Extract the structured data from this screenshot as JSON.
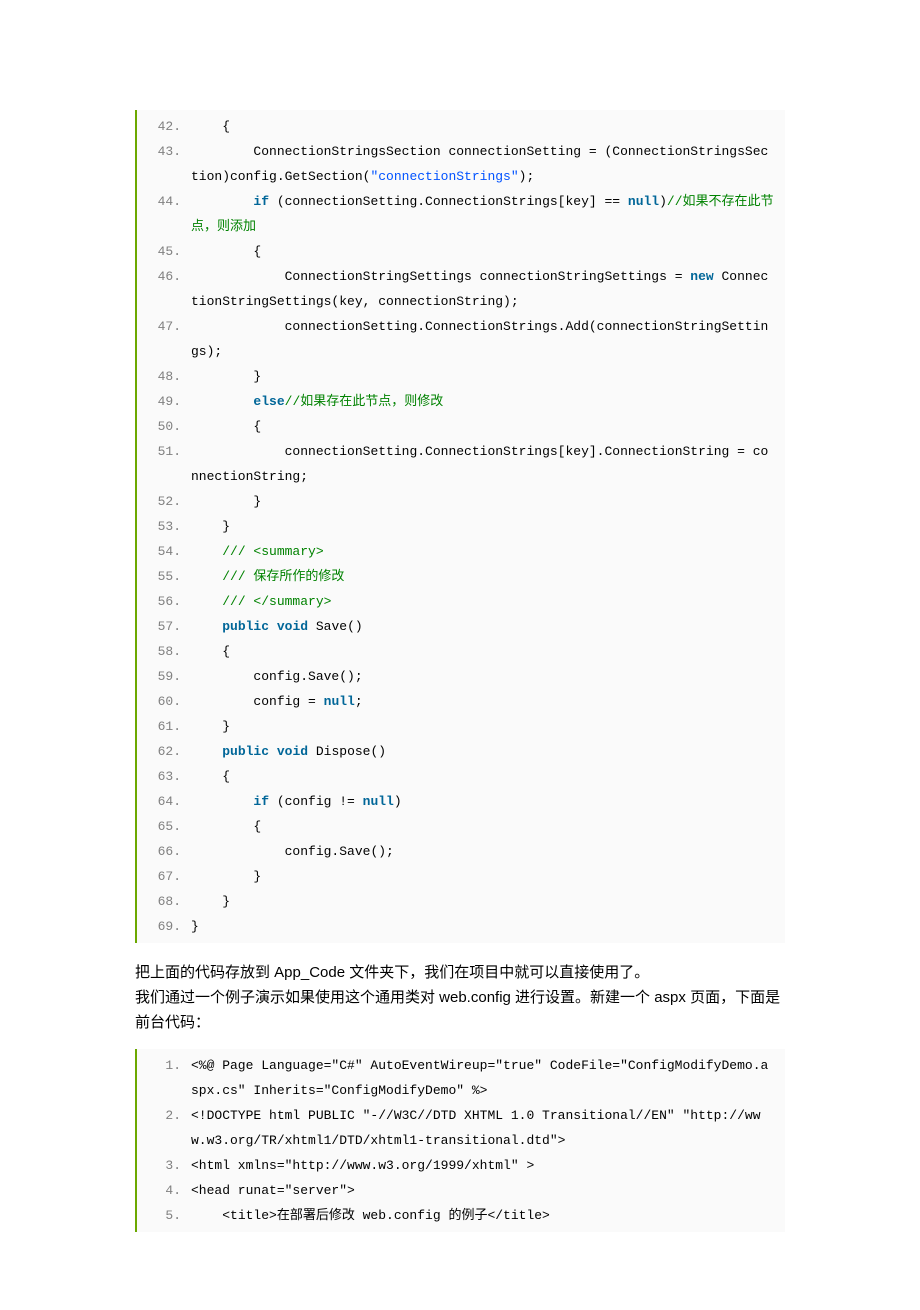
{
  "code1": {
    "start": 42,
    "lines": [
      [
        {
          "t": "    {",
          "c": ""
        }
      ],
      [
        {
          "t": "        ConnectionStringsSection connectionSetting = (ConnectionStringsSection)config.GetSection(",
          "c": ""
        },
        {
          "t": "\"connectionStrings\"",
          "c": "str"
        },
        {
          "t": ");",
          "c": ""
        }
      ],
      [
        {
          "t": "        ",
          "c": ""
        },
        {
          "t": "if",
          "c": "kw"
        },
        {
          "t": " (connectionSetting.ConnectionStrings[key] == ",
          "c": ""
        },
        {
          "t": "null",
          "c": "kw"
        },
        {
          "t": ")",
          "c": ""
        },
        {
          "t": "//如果不存在此节点，则添加",
          "c": "cmt"
        }
      ],
      [
        {
          "t": "        {",
          "c": ""
        }
      ],
      [
        {
          "t": "            ConnectionStringSettings connectionStringSettings = ",
          "c": ""
        },
        {
          "t": "new",
          "c": "kw"
        },
        {
          "t": " ConnectionStringSettings(key, connectionString);",
          "c": ""
        }
      ],
      [
        {
          "t": "            connectionSetting.ConnectionStrings.Add(connectionStringSettings);",
          "c": ""
        }
      ],
      [
        {
          "t": "        }",
          "c": ""
        }
      ],
      [
        {
          "t": "        ",
          "c": ""
        },
        {
          "t": "else",
          "c": "kw"
        },
        {
          "t": "//如果存在此节点，则修改",
          "c": "cmt"
        }
      ],
      [
        {
          "t": "        {",
          "c": ""
        }
      ],
      [
        {
          "t": "            connectionSetting.ConnectionStrings[key].ConnectionString = connectionString;",
          "c": ""
        }
      ],
      [
        {
          "t": "        }",
          "c": ""
        }
      ],
      [
        {
          "t": "    }",
          "c": ""
        }
      ],
      [
        {
          "t": "    ",
          "c": ""
        },
        {
          "t": "/// <summary>",
          "c": "cmt"
        }
      ],
      [
        {
          "t": "    ",
          "c": ""
        },
        {
          "t": "/// 保存所作的修改",
          "c": "cmt"
        }
      ],
      [
        {
          "t": "    ",
          "c": ""
        },
        {
          "t": "/// </summary>",
          "c": "cmt"
        }
      ],
      [
        {
          "t": "    ",
          "c": ""
        },
        {
          "t": "public",
          "c": "kw"
        },
        {
          "t": " ",
          "c": ""
        },
        {
          "t": "void",
          "c": "kw"
        },
        {
          "t": " Save()",
          "c": ""
        }
      ],
      [
        {
          "t": "    {",
          "c": ""
        }
      ],
      [
        {
          "t": "        config.Save();",
          "c": ""
        }
      ],
      [
        {
          "t": "        config = ",
          "c": ""
        },
        {
          "t": "null",
          "c": "kw"
        },
        {
          "t": ";",
          "c": ""
        }
      ],
      [
        {
          "t": "    }",
          "c": ""
        }
      ],
      [
        {
          "t": "    ",
          "c": ""
        },
        {
          "t": "public",
          "c": "kw"
        },
        {
          "t": " ",
          "c": ""
        },
        {
          "t": "void",
          "c": "kw"
        },
        {
          "t": " Dispose()",
          "c": ""
        }
      ],
      [
        {
          "t": "    {",
          "c": ""
        }
      ],
      [
        {
          "t": "        ",
          "c": ""
        },
        {
          "t": "if",
          "c": "kw"
        },
        {
          "t": " (config != ",
          "c": ""
        },
        {
          "t": "null",
          "c": "kw"
        },
        {
          "t": ")",
          "c": ""
        }
      ],
      [
        {
          "t": "        {",
          "c": ""
        }
      ],
      [
        {
          "t": "            config.Save();",
          "c": ""
        }
      ],
      [
        {
          "t": "        }",
          "c": ""
        }
      ],
      [
        {
          "t": "    }",
          "c": ""
        }
      ],
      [
        {
          "t": "}",
          "c": ""
        }
      ]
    ]
  },
  "paragraph": {
    "line1": "把上面的代码存放到 App_Code 文件夹下，我们在项目中就可以直接使用了。",
    "line2": "我们通过一个例子演示如果使用这个通用类对 web.config 进行设置。新建一个 aspx 页面，下面是前台代码："
  },
  "code2": {
    "start": 1,
    "lines": [
      [
        {
          "t": "<%@ Page Language=\"C#\" AutoEventWireup=\"true\" CodeFile=\"ConfigModifyDemo.aspx.cs\" Inherits=\"ConfigModifyDemo\" %>",
          "c": ""
        }
      ],
      [
        {
          "t": "<!DOCTYPE html PUBLIC \"-//W3C//DTD XHTML 1.0 Transitional//EN\" \"http://www.w3.org/TR/xhtml1/DTD/xhtml1-transitional.dtd\">",
          "c": ""
        }
      ],
      [
        {
          "t": "<html xmlns=\"http://www.w3.org/1999/xhtml\" >",
          "c": ""
        }
      ],
      [
        {
          "t": "<head runat=\"server\">",
          "c": ""
        }
      ],
      [
        {
          "t": "    <title>在部署后修改 web.config 的例子</title>",
          "c": ""
        }
      ]
    ]
  }
}
